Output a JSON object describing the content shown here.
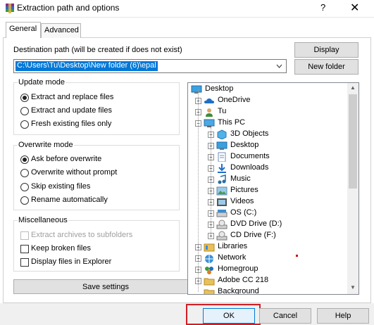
{
  "window": {
    "title": "Extraction path and options",
    "help_glyph": "?",
    "close_glyph": "✕"
  },
  "tabs": [
    {
      "label": "General"
    },
    {
      "label": "Advanced"
    }
  ],
  "destination": {
    "label": "Destination path (will be created if does not exist)",
    "value": "C:\\Users\\Tu\\Desktop\\New folder (6)\\epal"
  },
  "buttons": {
    "display": "Display",
    "new_folder": "New folder",
    "save_settings": "Save settings",
    "ok": "OK",
    "cancel": "Cancel",
    "help": "Help"
  },
  "update_mode": {
    "title": "Update mode",
    "options": [
      {
        "label": "Extract and replace files",
        "checked": true
      },
      {
        "label": "Extract and update files",
        "checked": false
      },
      {
        "label": "Fresh existing files only",
        "checked": false
      }
    ]
  },
  "overwrite_mode": {
    "title": "Overwrite mode",
    "options": [
      {
        "label": "Ask before overwrite",
        "checked": true
      },
      {
        "label": "Overwrite without prompt",
        "checked": false
      },
      {
        "label": "Skip existing files",
        "checked": false
      },
      {
        "label": "Rename automatically",
        "checked": false
      }
    ]
  },
  "miscellaneous": {
    "title": "Miscellaneous",
    "options": [
      {
        "label": "Extract archives to subfolders",
        "checked": false,
        "disabled": true
      },
      {
        "label": "Keep broken files",
        "checked": false,
        "disabled": false
      },
      {
        "label": "Display files in Explorer",
        "checked": false,
        "disabled": false
      }
    ]
  },
  "tree": {
    "items": [
      {
        "label": "Desktop",
        "icon": "desktop-folder-icon",
        "level": 0,
        "expander": ""
      },
      {
        "label": "OneDrive",
        "icon": "onedrive-icon",
        "level": 1,
        "expander": "+"
      },
      {
        "label": "Tu",
        "icon": "user-icon",
        "level": 1,
        "expander": "+"
      },
      {
        "label": "This PC",
        "icon": "computer-icon",
        "level": 1,
        "expander": "−"
      },
      {
        "label": "3D Objects",
        "icon": "3d-objects-icon",
        "level": 2,
        "expander": "+"
      },
      {
        "label": "Desktop",
        "icon": "desktop-folder-icon",
        "level": 2,
        "expander": "+"
      },
      {
        "label": "Documents",
        "icon": "documents-icon",
        "level": 2,
        "expander": "+"
      },
      {
        "label": "Downloads",
        "icon": "downloads-icon",
        "level": 2,
        "expander": "+"
      },
      {
        "label": "Music",
        "icon": "music-icon",
        "level": 2,
        "expander": "+"
      },
      {
        "label": "Pictures",
        "icon": "pictures-icon",
        "level": 2,
        "expander": "+"
      },
      {
        "label": "Videos",
        "icon": "videos-icon",
        "level": 2,
        "expander": "+"
      },
      {
        "label": "OS (C:)",
        "icon": "drive-icon",
        "level": 2,
        "expander": "+"
      },
      {
        "label": "DVD Drive (D:)",
        "icon": "dvd-drive-icon",
        "level": 2,
        "expander": "+"
      },
      {
        "label": "CD Drive (F:)",
        "icon": "cd-drive-icon",
        "level": 2,
        "expander": "+"
      },
      {
        "label": "Libraries",
        "icon": "libraries-icon",
        "level": 1,
        "expander": "+"
      },
      {
        "label": "Network",
        "icon": "network-icon",
        "level": 1,
        "expander": "+"
      },
      {
        "label": "Homegroup",
        "icon": "homegroup-icon",
        "level": 1,
        "expander": "+"
      },
      {
        "label": "Adobe CC 218",
        "icon": "folder-icon",
        "level": 1,
        "expander": "+"
      },
      {
        "label": "Background",
        "icon": "folder-icon",
        "level": 1,
        "expander": ""
      }
    ]
  },
  "colors": {
    "selection": "#0078d7",
    "highlight_border": "#d21d24",
    "folder": "#e8c15a"
  }
}
